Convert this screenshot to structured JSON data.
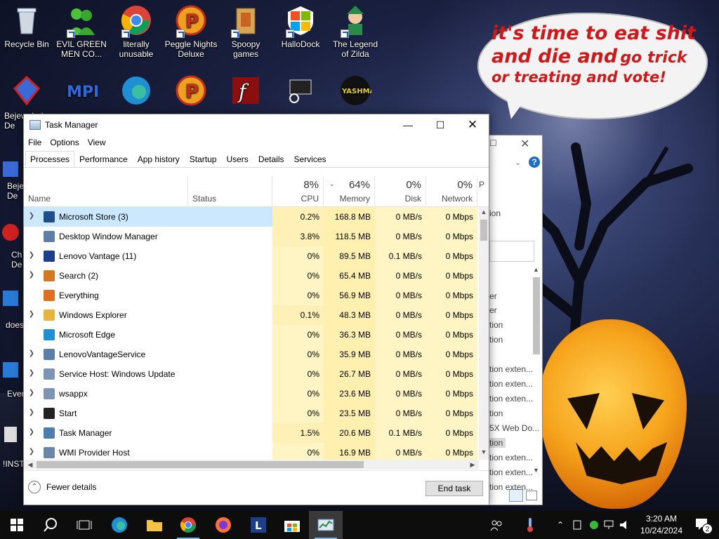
{
  "desktop": {
    "icons": [
      {
        "label": "Recycle Bin",
        "icon": "recycle-bin-icon"
      },
      {
        "label": "EVIL GREEN MEN CO...",
        "icon": "green-men-icon"
      },
      {
        "label": "literally unusable",
        "icon": "chrome-icon"
      },
      {
        "label": "Peggle Nights Deluxe",
        "icon": "peggle-icon"
      },
      {
        "label": "Spoopy games",
        "icon": "folder-icon"
      },
      {
        "label": "HalloDock",
        "icon": "windows-logo-icon"
      },
      {
        "label": "The Legend of Zilda",
        "icon": "zilda-icon"
      }
    ],
    "left_partial_labels": [
      "Bejeweled De",
      "Beje De",
      "Ch De",
      "does",
      "Ever",
      "!INST"
    ],
    "speech_bubble": {
      "line1": "it's time to eat shit",
      "line2a": "and die and",
      "line2b": "go trick",
      "line3": "or treating and vote!"
    }
  },
  "task_manager": {
    "title": "Task Manager",
    "menu": [
      "File",
      "Options",
      "View"
    ],
    "tabs": [
      "Processes",
      "Performance",
      "App history",
      "Startup",
      "Users",
      "Details",
      "Services"
    ],
    "active_tab": "Processes",
    "columns": {
      "name": "Name",
      "status": "Status",
      "cpu": {
        "pct": "8%",
        "label": "CPU"
      },
      "memory": {
        "pct": "64%",
        "label": "Memory"
      },
      "disk": {
        "pct": "0%",
        "label": "Disk"
      },
      "network": {
        "pct": "0%",
        "label": "Network"
      },
      "power_partial": "P"
    },
    "processes": [
      {
        "name": "Microsoft Store (3)",
        "expandable": true,
        "cpu": "0.2%",
        "mem": "168.8 MB",
        "disk": "0 MB/s",
        "net": "0 Mbps",
        "selected": true,
        "icon": "store-icon",
        "color": "#1f4e8c"
      },
      {
        "name": "Desktop Window Manager",
        "expandable": false,
        "cpu": "3.8%",
        "mem": "118.5 MB",
        "disk": "0 MB/s",
        "net": "0 Mbps",
        "icon": "window-icon",
        "color": "#5b7fa8"
      },
      {
        "name": "Lenovo Vantage (11)",
        "expandable": true,
        "cpu": "0%",
        "mem": "89.5 MB",
        "disk": "0.1 MB/s",
        "net": "0 Mbps",
        "icon": "lenovo-icon",
        "color": "#1b3f8a"
      },
      {
        "name": "Search (2)",
        "expandable": true,
        "cpu": "0%",
        "mem": "65.4 MB",
        "disk": "0 MB/s",
        "net": "0 Mbps",
        "icon": "search-icon",
        "color": "#d47a1c",
        "leaf": true
      },
      {
        "name": "Everything",
        "expandable": false,
        "cpu": "0%",
        "mem": "56.9 MB",
        "disk": "0 MB/s",
        "net": "0 Mbps",
        "icon": "magnifier-icon",
        "color": "#e07020"
      },
      {
        "name": "Windows Explorer",
        "expandable": true,
        "cpu": "0.1%",
        "mem": "48.3 MB",
        "disk": "0 MB/s",
        "net": "0 Mbps",
        "icon": "folder-icon",
        "color": "#e8b43a"
      },
      {
        "name": "Microsoft Edge",
        "expandable": false,
        "cpu": "0%",
        "mem": "36.3 MB",
        "disk": "0 MB/s",
        "net": "0 Mbps",
        "icon": "edge-icon",
        "color": "#1f8fd3"
      },
      {
        "name": "LenovoVantageService",
        "expandable": true,
        "cpu": "0%",
        "mem": "35.9 MB",
        "disk": "0 MB/s",
        "net": "0 Mbps",
        "icon": "window-icon",
        "color": "#5b7fa8"
      },
      {
        "name": "Service Host: Windows Update",
        "expandable": true,
        "cpu": "0%",
        "mem": "26.7 MB",
        "disk": "0 MB/s",
        "net": "0 Mbps",
        "icon": "gear-icon",
        "color": "#7d95b3"
      },
      {
        "name": "wsappx",
        "expandable": true,
        "cpu": "0%",
        "mem": "23.6 MB",
        "disk": "0 MB/s",
        "net": "0 Mbps",
        "icon": "gear-icon",
        "color": "#7d95b3"
      },
      {
        "name": "Start",
        "expandable": true,
        "cpu": "0%",
        "mem": "23.5 MB",
        "disk": "0 MB/s",
        "net": "0 Mbps",
        "icon": "start-icon",
        "color": "#222222"
      },
      {
        "name": "Task Manager",
        "expandable": true,
        "cpu": "1.5%",
        "mem": "20.6 MB",
        "disk": "0.1 MB/s",
        "net": "0 Mbps",
        "icon": "taskmgr-icon",
        "color": "#4e7cab"
      },
      {
        "name": "WMI Provider Host",
        "expandable": true,
        "cpu": "0%",
        "mem": "16.9 MB",
        "disk": "0 MB/s",
        "net": "0 Mbps",
        "icon": "wmi-icon",
        "color": "#6a86a8"
      }
    ],
    "footer": {
      "fewer_details": "Fewer details",
      "end_task": "End task"
    }
  },
  "background_window": {
    "items": [
      "ion",
      "er",
      "er",
      "tion",
      "tion",
      "tion exten...",
      "tion exten...",
      "tion exten...",
      "tion",
      "5X Web Do...",
      "tion",
      "tion exten...",
      "tion exten...",
      "tion exten..."
    ]
  },
  "taskbar": {
    "clock_time": "3:20 AM",
    "clock_date": "10/24/2024",
    "notification_count": "2"
  },
  "colors": {
    "cpu_heat": "#fff4c4",
    "mem_heat": "#fff0b0",
    "selected_row": "#cce8ff",
    "speech_red": "#d01818"
  }
}
